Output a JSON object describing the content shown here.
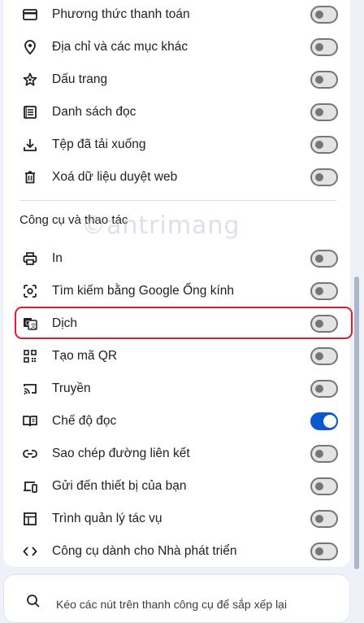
{
  "menu": {
    "items_top": [
      {
        "label": "Phương thức thanh toán",
        "icon": "credit-card-icon",
        "enabled": false
      },
      {
        "label": "Địa chỉ và các mục khác",
        "icon": "location-pin-icon",
        "enabled": false
      },
      {
        "label": "Dấu trang",
        "icon": "star-bookmark-icon",
        "enabled": false
      },
      {
        "label": "Danh sách đọc",
        "icon": "reading-list-icon",
        "enabled": false
      },
      {
        "label": "Tệp đã tải xuống",
        "icon": "download-icon",
        "enabled": false
      },
      {
        "label": "Xoá dữ liệu duyệt web",
        "icon": "trash-icon",
        "enabled": false
      }
    ],
    "section_title": "Công cụ và thao tác",
    "watermark": "©antrimang",
    "items_tools": [
      {
        "label": "In",
        "icon": "printer-icon",
        "enabled": false
      },
      {
        "label": "Tìm kiếm bằng Google Ống kính",
        "icon": "google-lens-icon",
        "enabled": false
      },
      {
        "label": "Dịch",
        "icon": "translate-icon",
        "enabled": false,
        "highlighted": true
      },
      {
        "label": "Tạo mã QR",
        "icon": "qr-code-icon",
        "enabled": false
      },
      {
        "label": "Truyền",
        "icon": "cast-icon",
        "enabled": false
      },
      {
        "label": "Chế độ đọc",
        "icon": "reading-mode-icon",
        "enabled": true
      },
      {
        "label": "Sao chép đường liên kết",
        "icon": "link-icon",
        "enabled": false
      },
      {
        "label": "Gửi đến thiết bị của bạn",
        "icon": "devices-icon",
        "enabled": false
      },
      {
        "label": "Trình quản lý tác vụ",
        "icon": "task-manager-icon",
        "enabled": false
      },
      {
        "label": "Công cụ dành cho Nhà phát triển",
        "icon": "code-brackets-icon",
        "enabled": false
      }
    ]
  },
  "hint": {
    "text": "Kéo các nút trên thanh công cụ để sắp xếp lại",
    "icon": "search-icon"
  },
  "colors": {
    "accent": "#0b57d0",
    "highlight_border": "#e21b2d",
    "background": "#eef2f8"
  }
}
